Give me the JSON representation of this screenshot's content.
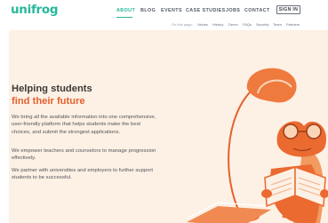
{
  "brand": {
    "logo_text": "unifrog",
    "accent_color": "#27b89c",
    "secondary_color": "#e2622f"
  },
  "nav": {
    "items": [
      {
        "label": "ABOUT",
        "active": true
      },
      {
        "label": "BLOG"
      },
      {
        "label": "EVENTS"
      },
      {
        "label": "CASE STUDIES"
      },
      {
        "label": "JOBS"
      },
      {
        "label": "CONTACT"
      }
    ],
    "signin_label": "SIGN IN"
  },
  "subnav": {
    "label": "On this page:",
    "items": [
      "Values",
      "History",
      "Demo",
      "FAQs",
      "Security",
      "Team",
      "Partners"
    ]
  },
  "hero": {
    "title_line1": "Helping students",
    "title_line2": "find their future",
    "paragraphs": [
      "We bring all the available information into one comprehensive, user-friendly platform that helps students make the best choices, and submit the strongest applications.",
      "We empower teachers and counselors to manage progression effectively.",
      "We partner with universities and employers to further support students to be successful."
    ],
    "illustration_icon": "frog-reading-under-lamp-illustration"
  }
}
